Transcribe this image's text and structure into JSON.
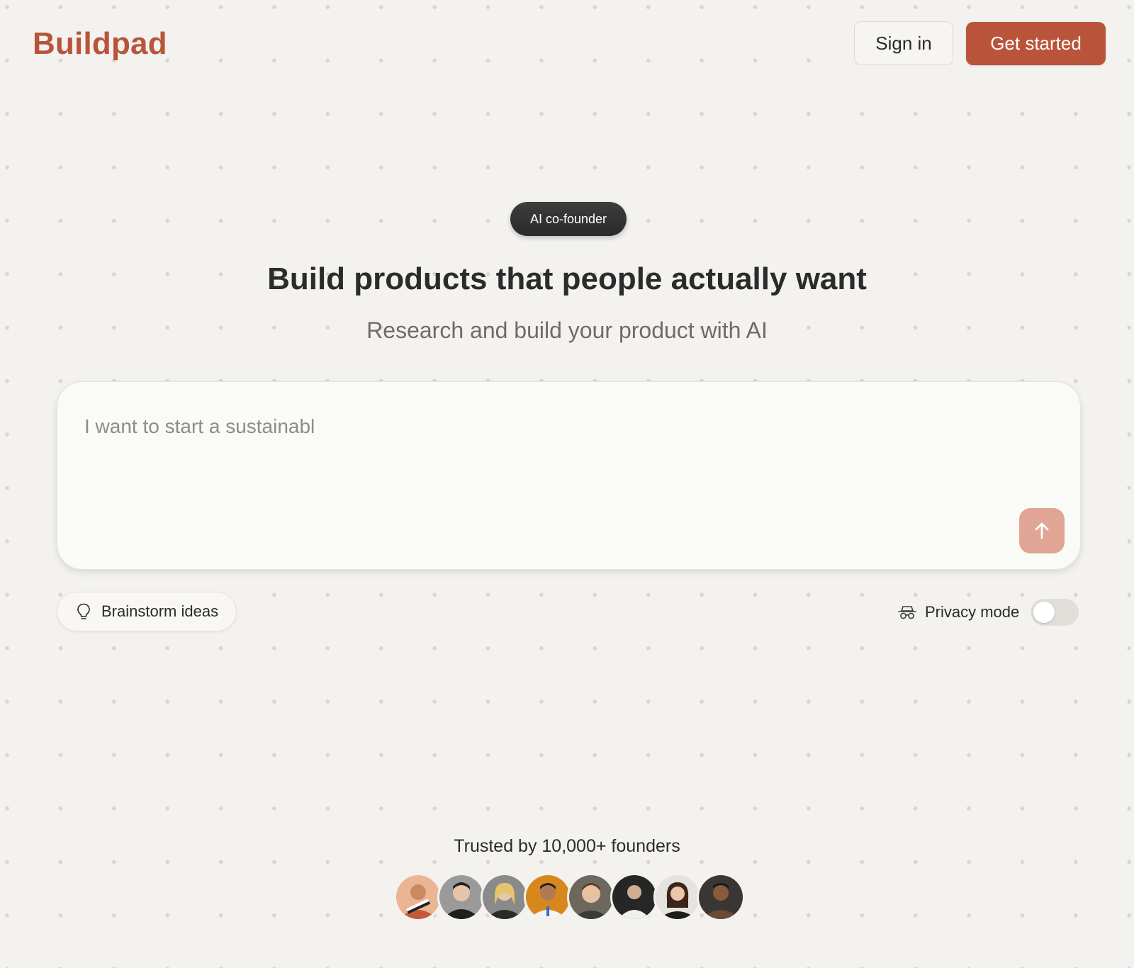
{
  "header": {
    "logo": "Buildpad",
    "sign_in_label": "Sign in",
    "get_started_label": "Get started"
  },
  "hero": {
    "badge": "AI co-founder",
    "headline": "Build products that people actually want",
    "subheadline": "Research and build your product with AI"
  },
  "prompt": {
    "value": "I want to start a sustainabl",
    "send_icon": "arrow-up-icon"
  },
  "actions": {
    "brainstorm_label": "Brainstorm ideas",
    "brainstorm_icon": "lightbulb-icon",
    "privacy_label": "Privacy mode",
    "privacy_icon": "incognito-icon",
    "privacy_enabled": false
  },
  "social_proof": {
    "text": "Trusted by 10,000+ founders",
    "avatars": [
      {
        "name": "founder-avatar-1",
        "bg": "#e6b08f"
      },
      {
        "name": "founder-avatar-2",
        "bg": "#2b2b2b"
      },
      {
        "name": "founder-avatar-3",
        "bg": "#7c7c7c"
      },
      {
        "name": "founder-avatar-4",
        "bg": "#d6861f"
      },
      {
        "name": "founder-avatar-5",
        "bg": "#6b6459"
      },
      {
        "name": "founder-avatar-6",
        "bg": "#262626"
      },
      {
        "name": "founder-avatar-7",
        "bg": "#dedad5"
      },
      {
        "name": "founder-avatar-8",
        "bg": "#3a3633"
      }
    ]
  },
  "colors": {
    "brand": "#b9543a",
    "send_button": "#e0a594",
    "background": "#f3f2ee",
    "badge": "#333333"
  }
}
